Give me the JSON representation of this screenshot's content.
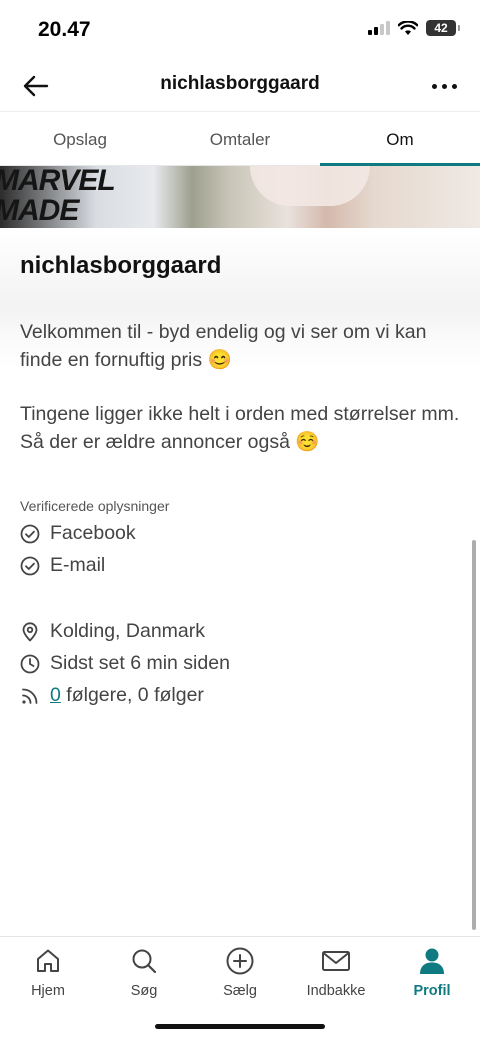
{
  "status": {
    "time": "20.47",
    "battery": "42"
  },
  "header": {
    "title": "nichlasborggaard"
  },
  "tabs": [
    {
      "label": "Opslag"
    },
    {
      "label": "Omtaler"
    },
    {
      "label": "Om"
    }
  ],
  "cover": {
    "text_line1": "MARVEL",
    "text_line2": "MADE"
  },
  "profile": {
    "username": "nichlasborggaard",
    "bio_1": "Velkommen til - byd endelig og vi ser om vi kan finde en fornuftig pris 😊",
    "bio_2": "Tingene ligger ikke helt i orden med størrelser mm. Så der er ældre annoncer også ☺️",
    "verified_heading": "Verificerede oplysninger",
    "verified": [
      "Facebook",
      "E-mail"
    ],
    "location": "Kolding, Danmark",
    "last_seen": "Sidst set 6 min siden",
    "followers_count": "0",
    "follow_text": " følgere, 0 følger"
  },
  "bottom_nav": [
    {
      "label": "Hjem",
      "icon": "home-icon"
    },
    {
      "label": "Søg",
      "icon": "search-icon"
    },
    {
      "label": "Sælg",
      "icon": "plus-circle-icon"
    },
    {
      "label": "Indbakke",
      "icon": "mail-icon"
    },
    {
      "label": "Profil",
      "icon": "profile-icon"
    }
  ],
  "colors": {
    "accent": "#0f7a82",
    "text": "#111111",
    "muted": "#444444"
  }
}
